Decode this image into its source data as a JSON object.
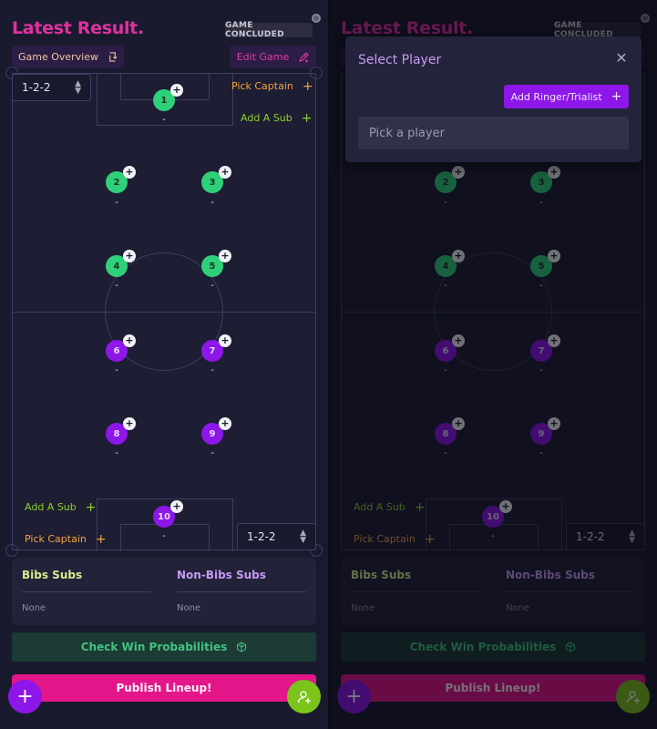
{
  "header": {
    "title": "Latest Result.",
    "status_badge": "GAME CONCLUDED"
  },
  "actions": {
    "game_overview": "Game Overview",
    "edit_game": "Edit Game"
  },
  "pitch": {
    "top_formation": "1-2-2",
    "bottom_formation": "1-2-2",
    "top_pick_captain": "Pick Captain",
    "top_add_sub": "Add A Sub",
    "bottom_add_sub": "Add A Sub",
    "bottom_pick_captain": "Pick Captain",
    "players": [
      {
        "number": "1",
        "name": "-",
        "team": "green"
      },
      {
        "number": "2",
        "name": "-",
        "team": "green"
      },
      {
        "number": "3",
        "name": "-",
        "team": "green"
      },
      {
        "number": "4",
        "name": "-",
        "team": "green"
      },
      {
        "number": "5",
        "name": "-",
        "team": "green"
      },
      {
        "number": "6",
        "name": "-",
        "team": "purple"
      },
      {
        "number": "7",
        "name": "-",
        "team": "purple"
      },
      {
        "number": "8",
        "name": "-",
        "team": "purple"
      },
      {
        "number": "9",
        "name": "-",
        "team": "purple"
      },
      {
        "number": "10",
        "name": "-",
        "team": "purple"
      }
    ],
    "add_glyph": "+"
  },
  "subs": {
    "bibs_title": "Bibs Subs",
    "bibs_value": "None",
    "non_bibs_title": "Non-Bibs Subs",
    "non_bibs_value": "None"
  },
  "footer": {
    "check_win": "Check Win Probabilities",
    "publish": "Publish Lineup!"
  },
  "modal": {
    "title": "Select Player",
    "add_ringer": "Add Ringer/Trialist",
    "search_placeholder": "Pick a player"
  },
  "colors": {
    "accent_pink": "#e3168a",
    "accent_purple": "#8d16e8",
    "team_green": "#2fd07a",
    "sub_green": "#8ad22a",
    "captain_orange": "#f4a340"
  },
  "icons": [
    "swap-icon",
    "edit-pen-icon",
    "plus-icon",
    "chevron-updown-icon",
    "dice-icon",
    "add-user-icon",
    "close-icon"
  ]
}
